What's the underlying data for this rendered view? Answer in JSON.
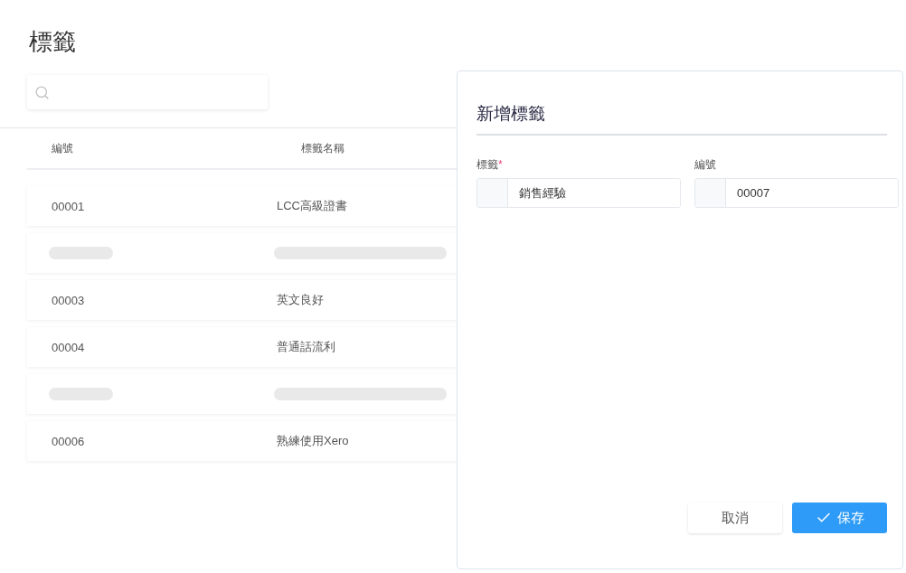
{
  "page_title": "標籤",
  "table": {
    "columns": [
      "編號",
      "標籤名稱"
    ],
    "rows": [
      {
        "kind": "data",
        "cells": [
          "00001",
          "LCC高級證書"
        ]
      },
      {
        "kind": "loading"
      },
      {
        "kind": "data",
        "cells": [
          "00003",
          "英文良好"
        ]
      },
      {
        "kind": "data",
        "cells": [
          "00004",
          "普通話流利"
        ]
      },
      {
        "kind": "loading"
      },
      {
        "kind": "data",
        "cells": [
          "00006",
          "熟練使用Xero"
        ]
      }
    ]
  },
  "panel": {
    "title": "新增標籤",
    "fields": [
      {
        "label": "標籤",
        "required_mark": "*",
        "value": "銷售經驗"
      },
      {
        "label": "編號",
        "value": "00007"
      }
    ],
    "buttons": [
      {
        "kind": "secondary",
        "label": "取消"
      },
      {
        "kind": "primary",
        "label": "保存"
      }
    ]
  }
}
